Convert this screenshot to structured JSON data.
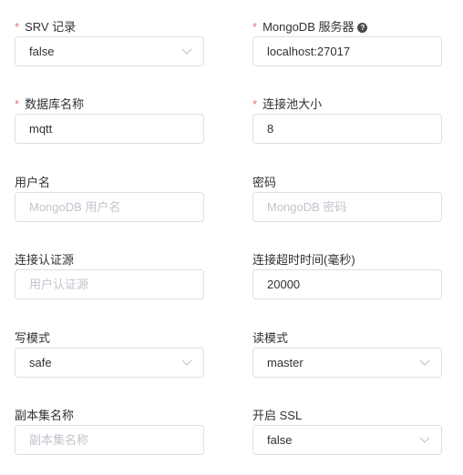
{
  "form": {
    "srv": {
      "label": "SRV 记录",
      "value": "false"
    },
    "server": {
      "label": "MongoDB 服务器",
      "value": "localhost:27017",
      "help_icon": "question-circle-icon"
    },
    "database": {
      "label": "数据库名称",
      "value": "mqtt"
    },
    "pool_size": {
      "label": "连接池大小",
      "value": "8"
    },
    "username": {
      "label": "用户名",
      "placeholder": "MongoDB 用户名"
    },
    "password": {
      "label": "密码",
      "placeholder": "MongoDB 密码"
    },
    "auth_source": {
      "label": "连接认证源",
      "placeholder": "用户认证源"
    },
    "timeout": {
      "label": "连接超时时间(毫秒)",
      "value": "20000"
    },
    "write_mode": {
      "label": "写模式",
      "value": "safe"
    },
    "read_mode": {
      "label": "读模式",
      "value": "master"
    },
    "replica_set": {
      "label": "副本集名称",
      "placeholder": "副本集名称"
    },
    "ssl": {
      "label": "开启 SSL",
      "value": "false"
    }
  },
  "required_marker": "*",
  "colors": {
    "required": "#f56c6c",
    "border": "#dcdfe6",
    "placeholder": "#c0c4cc",
    "text": "#303133"
  }
}
